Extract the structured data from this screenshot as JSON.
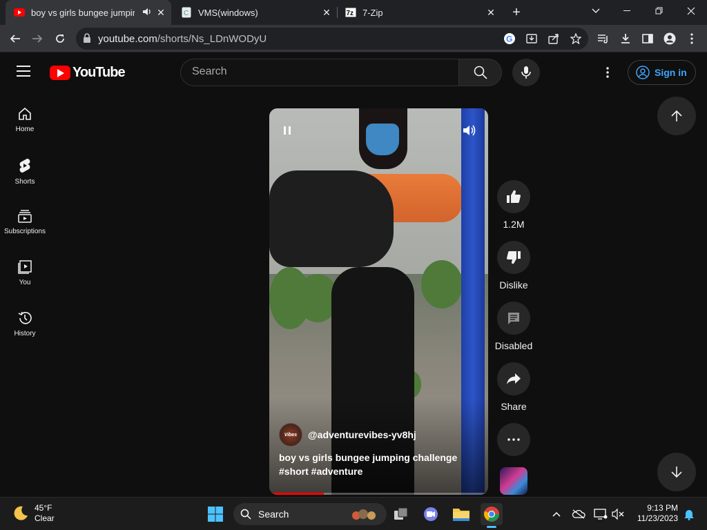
{
  "browser": {
    "tabs": [
      {
        "title": "boy vs girls bungee jumping",
        "favicon": "youtube-icon",
        "active": true
      },
      {
        "title": "VMS(windows)",
        "favicon": "doc-icon",
        "active": false
      },
      {
        "title": "7-Zip",
        "favicon": "sevenzip-icon",
        "active": false
      }
    ],
    "url_host": "youtube.com",
    "url_path": "/shorts/Ns_LDnWODyU"
  },
  "youtube": {
    "logo_text": "YouTube",
    "search_placeholder": "Search",
    "signin_label": "Sign in",
    "sidebar": [
      {
        "label": "Home",
        "icon": "home-icon"
      },
      {
        "label": "Shorts",
        "icon": "shorts-icon"
      },
      {
        "label": "Subscriptions",
        "icon": "subscriptions-icon"
      },
      {
        "label": "You",
        "icon": "library-icon"
      },
      {
        "label": "History",
        "icon": "history-icon"
      }
    ],
    "short": {
      "channel_handle": "@adventurevibes-yv8hj",
      "channel_avatar_text": "Vibes",
      "title": "boy vs girls bungee jumping challenge #short #adventure",
      "progress": 0.25
    },
    "actions": {
      "like_count": "1.2M",
      "dislike_label": "Dislike",
      "comments_label": "Disabled",
      "share_label": "Share"
    }
  },
  "taskbar": {
    "weather_temp": "45°F",
    "weather_desc": "Clear",
    "search_label": "Search",
    "time": "9:13 PM",
    "date": "11/23/2023"
  }
}
